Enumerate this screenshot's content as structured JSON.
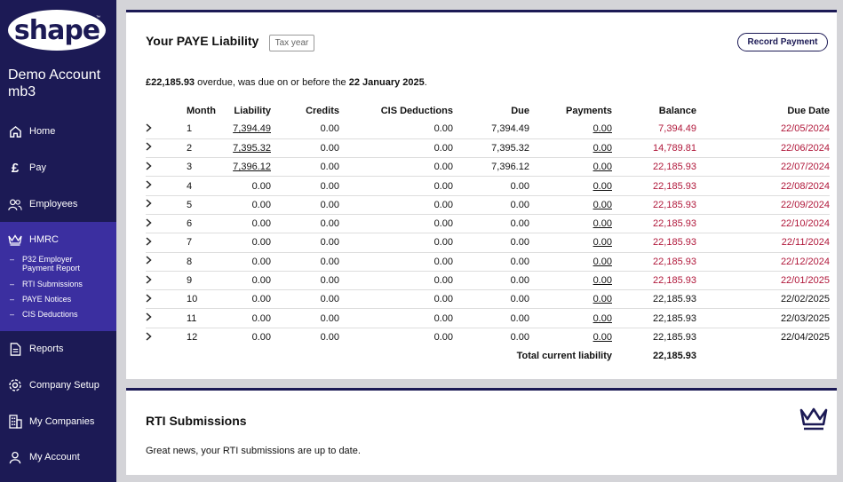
{
  "sidebar": {
    "logo_text": "shape",
    "logo_tm": "™",
    "account_name": "Demo Account mb3",
    "items": [
      {
        "label": "Home",
        "icon": "home-icon"
      },
      {
        "label": "Pay",
        "icon": "pound-icon"
      },
      {
        "label": "Employees",
        "icon": "users-icon"
      },
      {
        "label": "HMRC",
        "icon": "crown-icon"
      },
      {
        "label": "Reports",
        "icon": "document-icon"
      },
      {
        "label": "Company Setup",
        "icon": "gear-icon"
      },
      {
        "label": "My Companies",
        "icon": "building-icon"
      },
      {
        "label": "My Account",
        "icon": "user-icon"
      }
    ],
    "hmrc_subitems": [
      "P32 Employer Payment Report",
      "RTI Submissions",
      "PAYE Notices",
      "CIS Deductions"
    ]
  },
  "paye": {
    "title": "Your PAYE Liability",
    "tax_year_placeholder": "Tax year",
    "record_payment": "Record Payment",
    "overdue_amount": "£22,185.93",
    "overdue_text_1": " overdue, was due on or before the ",
    "overdue_date": "22 January 2025",
    "overdue_text_2": ".",
    "headers": [
      "Month",
      "Liability",
      "Credits",
      "CIS Deductions",
      "Due",
      "Payments",
      "Balance",
      "Due Date"
    ],
    "rows": [
      {
        "month": "1",
        "liability": "7,394.49",
        "credits": "0.00",
        "cis": "0.00",
        "due": "7,394.49",
        "payments": "0.00",
        "balance": "7,394.49",
        "due_date": "22/05/2024",
        "overdue": true,
        "liability_link": true
      },
      {
        "month": "2",
        "liability": "7,395.32",
        "credits": "0.00",
        "cis": "0.00",
        "due": "7,395.32",
        "payments": "0.00",
        "balance": "14,789.81",
        "due_date": "22/06/2024",
        "overdue": true,
        "liability_link": true
      },
      {
        "month": "3",
        "liability": "7,396.12",
        "credits": "0.00",
        "cis": "0.00",
        "due": "7,396.12",
        "payments": "0.00",
        "balance": "22,185.93",
        "due_date": "22/07/2024",
        "overdue": true,
        "liability_link": true
      },
      {
        "month": "4",
        "liability": "0.00",
        "credits": "0.00",
        "cis": "0.00",
        "due": "0.00",
        "payments": "0.00",
        "balance": "22,185.93",
        "due_date": "22/08/2024",
        "overdue": true,
        "liability_link": false
      },
      {
        "month": "5",
        "liability": "0.00",
        "credits": "0.00",
        "cis": "0.00",
        "due": "0.00",
        "payments": "0.00",
        "balance": "22,185.93",
        "due_date": "22/09/2024",
        "overdue": true,
        "liability_link": false
      },
      {
        "month": "6",
        "liability": "0.00",
        "credits": "0.00",
        "cis": "0.00",
        "due": "0.00",
        "payments": "0.00",
        "balance": "22,185.93",
        "due_date": "22/10/2024",
        "overdue": true,
        "liability_link": false
      },
      {
        "month": "7",
        "liability": "0.00",
        "credits": "0.00",
        "cis": "0.00",
        "due": "0.00",
        "payments": "0.00",
        "balance": "22,185.93",
        "due_date": "22/11/2024",
        "overdue": true,
        "liability_link": false
      },
      {
        "month": "8",
        "liability": "0.00",
        "credits": "0.00",
        "cis": "0.00",
        "due": "0.00",
        "payments": "0.00",
        "balance": "22,185.93",
        "due_date": "22/12/2024",
        "overdue": true,
        "liability_link": false
      },
      {
        "month": "9",
        "liability": "0.00",
        "credits": "0.00",
        "cis": "0.00",
        "due": "0.00",
        "payments": "0.00",
        "balance": "22,185.93",
        "due_date": "22/01/2025",
        "overdue": true,
        "liability_link": false
      },
      {
        "month": "10",
        "liability": "0.00",
        "credits": "0.00",
        "cis": "0.00",
        "due": "0.00",
        "payments": "0.00",
        "balance": "22,185.93",
        "due_date": "22/02/2025",
        "overdue": false,
        "liability_link": false
      },
      {
        "month": "11",
        "liability": "0.00",
        "credits": "0.00",
        "cis": "0.00",
        "due": "0.00",
        "payments": "0.00",
        "balance": "22,185.93",
        "due_date": "22/03/2025",
        "overdue": false,
        "liability_link": false
      },
      {
        "month": "12",
        "liability": "0.00",
        "credits": "0.00",
        "cis": "0.00",
        "due": "0.00",
        "payments": "0.00",
        "balance": "22,185.93",
        "due_date": "22/04/2025",
        "overdue": false,
        "liability_link": false
      }
    ],
    "total_label": "Total current liability",
    "total_value": "22,185.93"
  },
  "rti": {
    "title": "RTI Submissions",
    "message": "Great news, your RTI submissions are up to date.",
    "icon": "crown-icon"
  },
  "colors": {
    "navy": "#1c1a55",
    "hmrc_highlight": "#3b2fa0",
    "overdue_red": "#b0173a"
  }
}
